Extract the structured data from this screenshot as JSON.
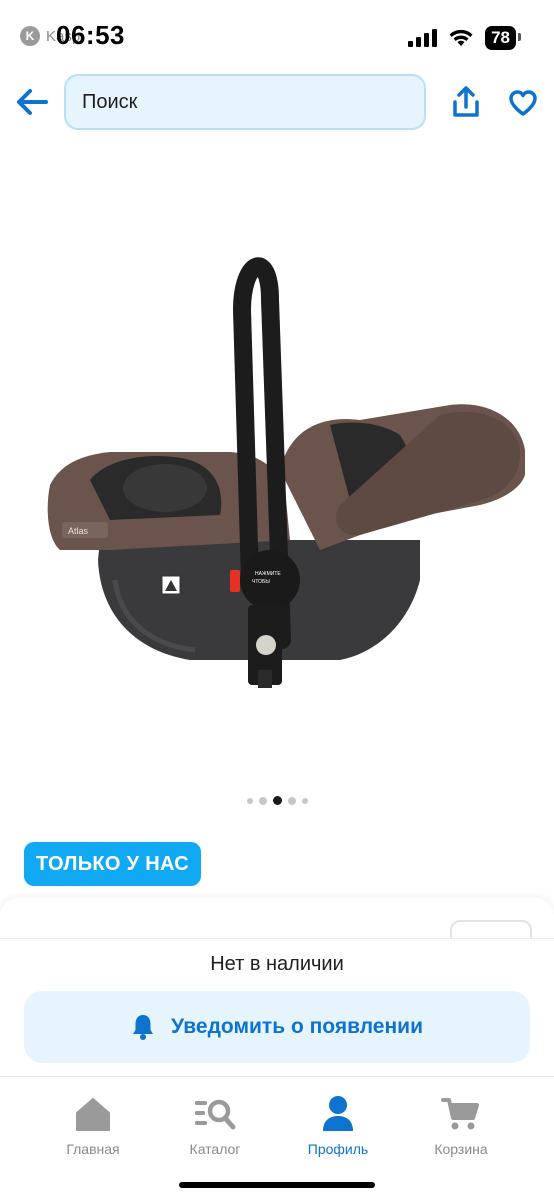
{
  "status_bar": {
    "back_app": "Kaspi",
    "time": "06:53",
    "battery": "78"
  },
  "top_bar": {
    "search_placeholder": "Поиск"
  },
  "gallery": {
    "image_icon": "infant-car-seat-image",
    "current_index": 3,
    "total": 5
  },
  "product": {
    "badge": "ТОЛЬКО У НАС",
    "car_seat_label": "Atlas"
  },
  "action_sheet": {
    "availability": "Нет в наличии",
    "notify_label": "Уведомить о появлении"
  },
  "tab_bar": {
    "items": [
      {
        "label": "Главная",
        "icon": "home-icon"
      },
      {
        "label": "Каталог",
        "icon": "catalog-search-icon"
      },
      {
        "label": "Профиль",
        "icon": "profile-icon"
      },
      {
        "label": "Корзина",
        "icon": "cart-icon"
      }
    ],
    "active_index": 2
  },
  "colors": {
    "accent": "#0d73cf",
    "badge_bg": "#11a9f3",
    "search_bg": "#e6f4fd",
    "inactive": "#8a8a8a"
  }
}
